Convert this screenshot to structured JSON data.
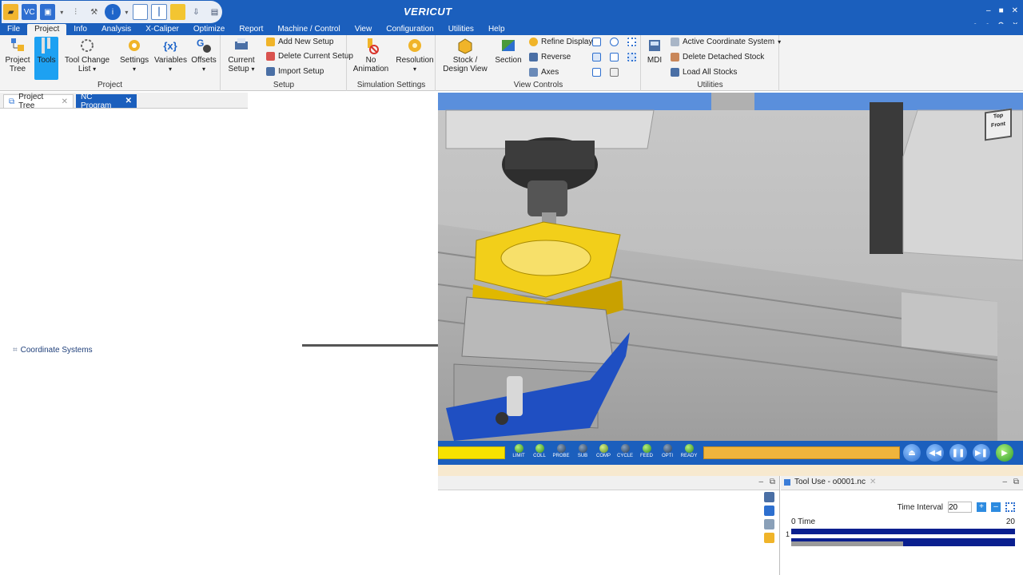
{
  "app": {
    "brand": "VERICUT"
  },
  "window_controls": [
    "–",
    "■",
    "✕"
  ],
  "window_controls2": [
    "●",
    "●",
    "⚙",
    "✕"
  ],
  "menus": [
    "File",
    "Project",
    "Info",
    "Analysis",
    "X-Caliper",
    "Optimize",
    "Report",
    "Machine / Control",
    "View",
    "Configuration",
    "Utilities",
    "Help"
  ],
  "ribbon": {
    "project": {
      "label": "Project",
      "project_tree": "Project Tree",
      "tools": "Tools",
      "tool_change_list": "Tool Change List",
      "settings": "Settings",
      "variables": "Variables",
      "offsets": "Offsets"
    },
    "setup": {
      "label": "Setup",
      "current_setup": "Current Setup",
      "add_new_setup": "Add New Setup",
      "delete_current_setup": "Delete Current Setup",
      "import_setup": "Import Setup"
    },
    "simulation": {
      "label": "Simulation Settings",
      "no_animation": "No Animation",
      "resolution": "Resolution"
    },
    "view_controls": {
      "label": "View Controls",
      "stock_design_view": "Stock / Design View",
      "section": "Section",
      "refine_display": "Refine Display",
      "reverse": "Reverse",
      "axes": "Axes"
    },
    "utilities": {
      "label": "Utilities",
      "mdi": "MDI",
      "active_coordinate_system": "Active Coordinate System",
      "delete_detached_stock": "Delete Detached Stock",
      "load_all_stocks": "Load All Stocks"
    }
  },
  "doc_tabs": {
    "project_tree": "Project Tree",
    "nc_program": "NC Program"
  },
  "tree": {
    "coordinate_systems": "Coordinate Systems"
  },
  "viewcube": {
    "top": "Top",
    "front": "Front"
  },
  "status_leds": [
    "LIMIT",
    "COLL",
    "PROBE",
    "SUB",
    "COMP",
    "CYCLE",
    "FEED",
    "OPTI",
    "READY"
  ],
  "tool_use": {
    "title": "Tool Use - o0001.nc",
    "time_interval_label": "Time Interval",
    "time_interval_value": "20",
    "axis_start": "0 Time",
    "axis_end": "20",
    "row_label": "1"
  }
}
